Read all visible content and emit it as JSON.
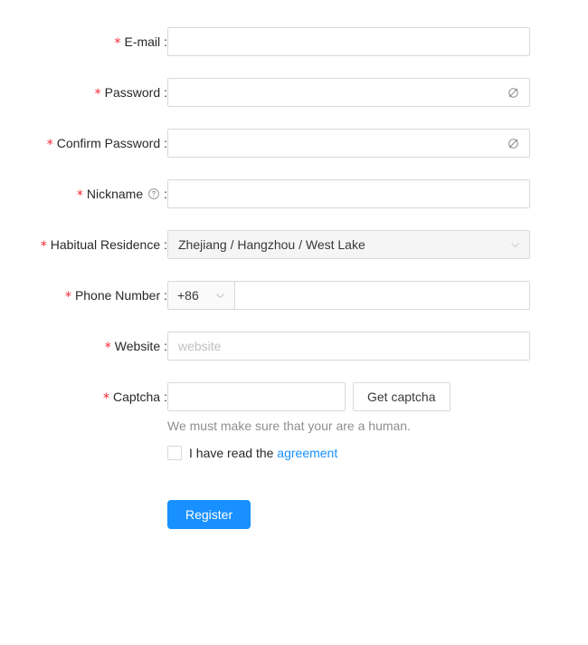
{
  "form": {
    "fields": [
      {
        "id": "email",
        "label": "E-mail",
        "required_mark": "*",
        "colon": ":",
        "value": "",
        "placeholder": ""
      },
      {
        "id": "password",
        "label": "Password",
        "required_mark": "*",
        "colon": ":",
        "value": "",
        "placeholder": "",
        "suffix_icon": "eye-invisible-icon"
      },
      {
        "id": "confirm-password",
        "label": "Confirm Password",
        "required_mark": "*",
        "colon": ":",
        "value": "",
        "placeholder": "",
        "suffix_icon": "eye-invisible-icon"
      },
      {
        "id": "nickname",
        "label": "Nickname",
        "required_mark": "*",
        "colon": ":",
        "value": "",
        "placeholder": "",
        "help_icon": "question-circle-icon"
      },
      {
        "id": "habitual-residence",
        "label": "Habitual Residence",
        "required_mark": "*",
        "colon": ":",
        "value": "Zhejiang / Hangzhou / West Lake",
        "arrow_icon": "chevron-down-icon"
      },
      {
        "id": "phone-number",
        "label": "Phone Number",
        "required_mark": "*",
        "colon": ":",
        "prefix_value": "+86",
        "prefix_arrow_icon": "chevron-down-icon",
        "value": "",
        "placeholder": ""
      },
      {
        "id": "website",
        "label": "Website",
        "required_mark": "*",
        "colon": ":",
        "value": "",
        "placeholder": "website"
      },
      {
        "id": "captcha",
        "label": "Captcha",
        "required_mark": "*",
        "colon": ":",
        "value": "",
        "placeholder": "",
        "button_label": "Get captcha",
        "extra": "We must make sure that your are a human."
      }
    ],
    "agreement": {
      "checked": false,
      "text_before": "I have read the",
      "link_label": "agreement"
    },
    "submit": {
      "label": "Register"
    }
  },
  "colors": {
    "primary": "#1890ff",
    "required_asterisk": "#f5222d",
    "border": "#d9d9d9",
    "placeholder": "#bfbfbf",
    "text": "rgba(0,0,0,0.85)",
    "muted_text": "rgba(0,0,0,0.45)",
    "cascader_background": "#f5f5f6",
    "addon_background": "#fafafa"
  }
}
